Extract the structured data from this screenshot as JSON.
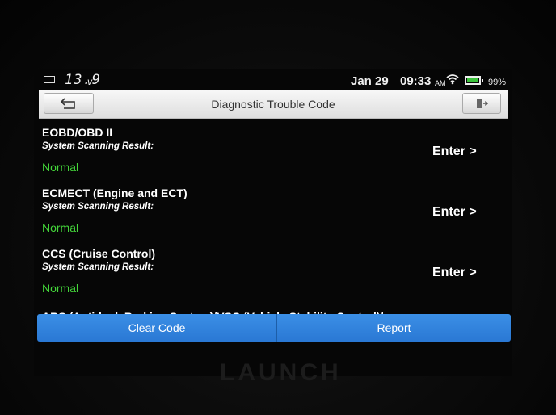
{
  "status_bar": {
    "voltage": "13.9",
    "voltage_unit": "v",
    "date": "Jan 29",
    "time": "09:33",
    "ampm": "AM",
    "battery_percent_label": "99%",
    "battery_level": 0.99,
    "icons": [
      "battery-small-icon",
      "wifi-icon",
      "battery-icon"
    ]
  },
  "header": {
    "title": "Diagnostic Trouble Code",
    "back_icon": "back-arrow-icon",
    "exit_icon": "exit-icon"
  },
  "systems": [
    {
      "name": "EOBD/OBD II",
      "subtitle": "System Scanning Result:",
      "status": "Normal",
      "action": "Enter >"
    },
    {
      "name": "ECMECT (Engine and ECT)",
      "subtitle": "System Scanning Result:",
      "status": "Normal",
      "action": "Enter >"
    },
    {
      "name": "CCS (Cruise Control)",
      "subtitle": "System Scanning Result:",
      "status": "Normal",
      "action": "Enter >"
    }
  ],
  "partial_row": "ABS (Anti-lock Braking System)/VSC (Vehicle Stability Control)/",
  "buttons": {
    "clear_code": "Clear Code",
    "report": "Report"
  },
  "brand": "LAUNCH",
  "colors": {
    "status_normal": "#44d63a",
    "button_blue": "#2f80dc",
    "title_bar": "#e8e8e8"
  }
}
